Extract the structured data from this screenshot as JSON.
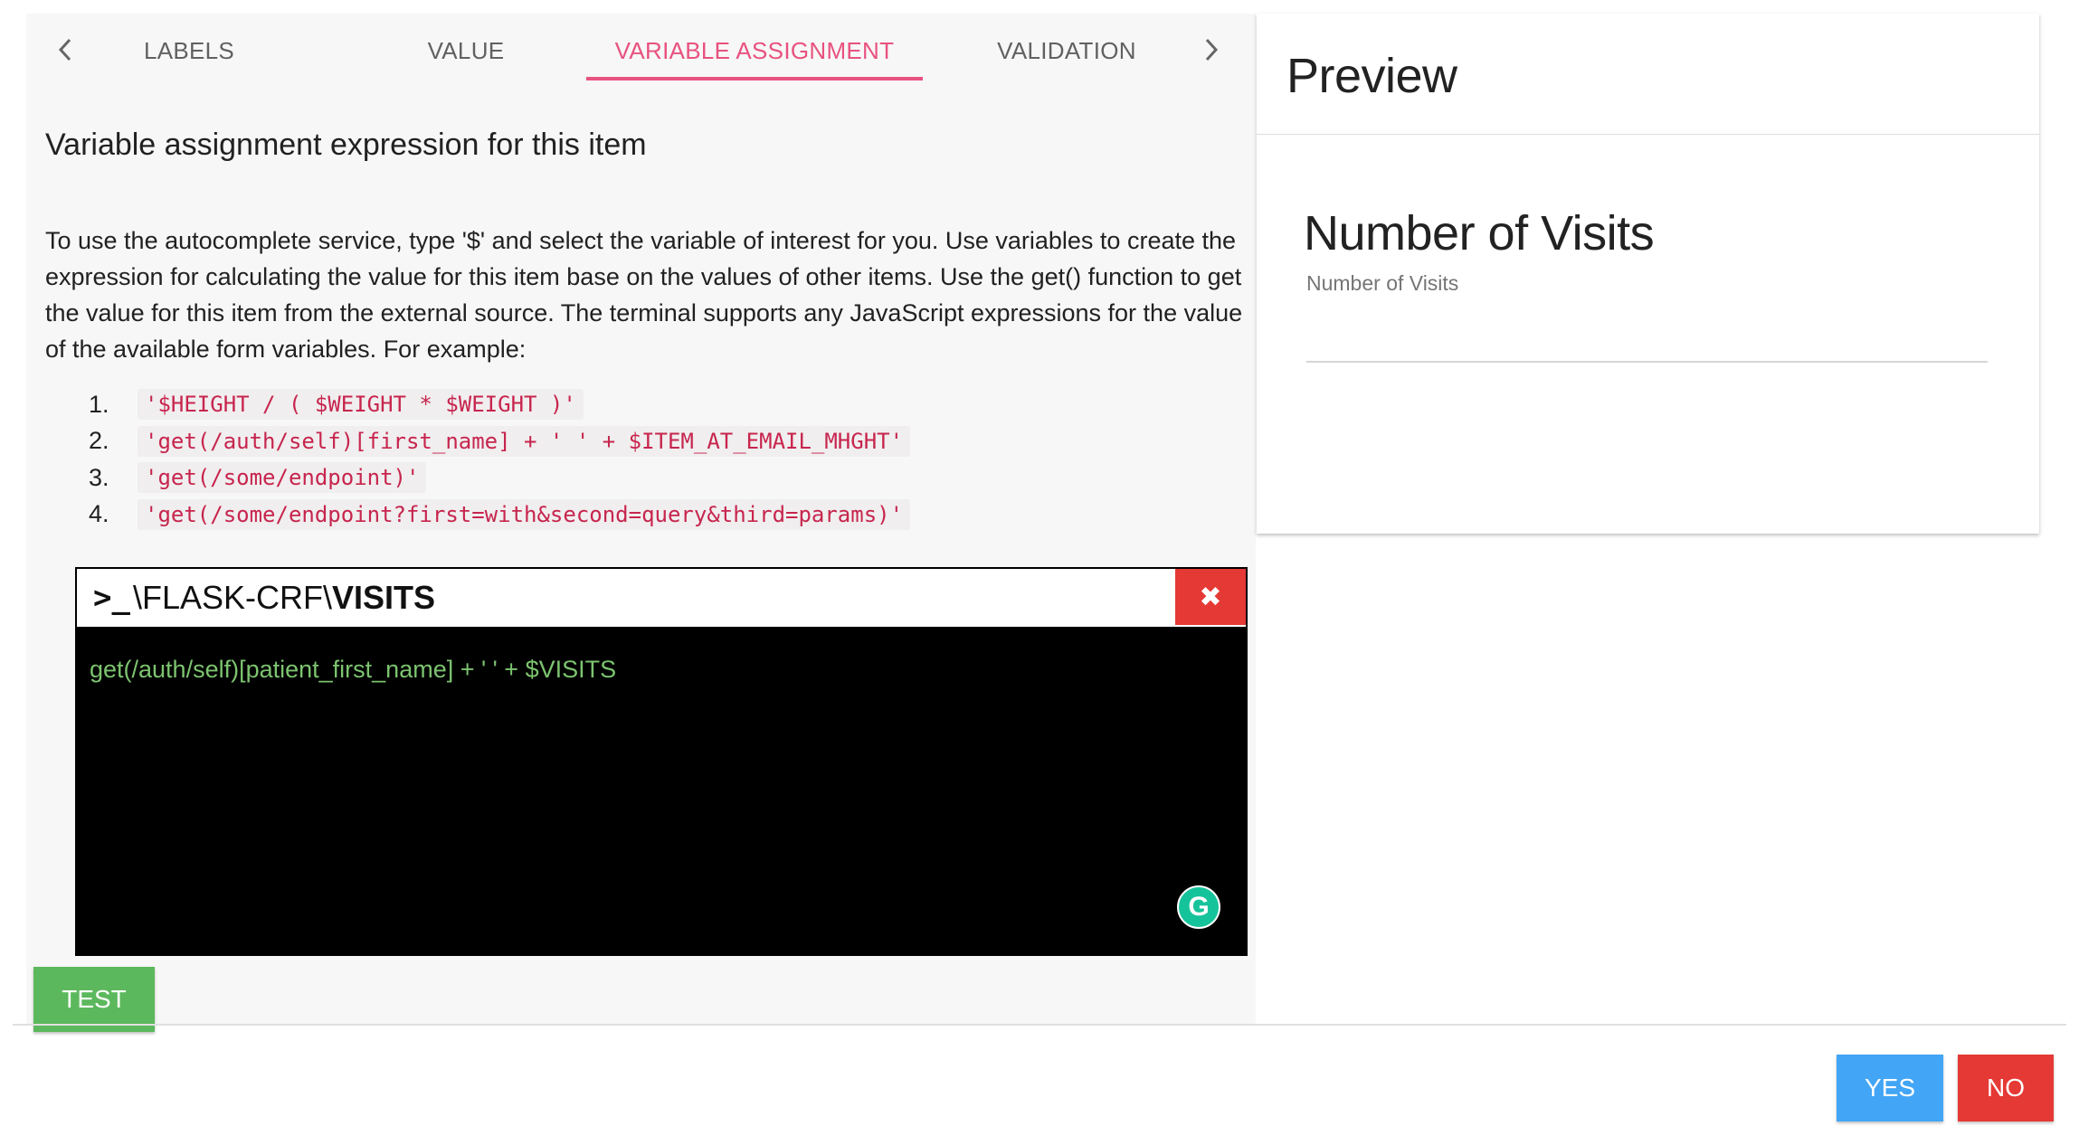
{
  "tabs": {
    "items": [
      "LABELS",
      "VALUE",
      "VARIABLE ASSIGNMENT",
      "VALIDATION"
    ],
    "active": "VARIABLE ASSIGNMENT",
    "prev_icon": "chevron-left-icon",
    "next_icon": "chevron-right-icon"
  },
  "editor": {
    "title": "Variable assignment expression for this item",
    "description": "To use the autocomplete service, type '$' and select the variable of interest for you. Use variables to create the expression for calculating the value for this item base on the values of other items. Use the get() function to get the value for this item from the external source. The terminal supports any JavaScript expressions for the value of the available form variables. For example:",
    "examples": [
      {
        "num": "1.",
        "code": "'$HEIGHT / ( $WEIGHT * $WEIGHT )'"
      },
      {
        "num": "2.",
        "code": "'get(/auth/self)[first_name] + ' ' + $ITEM_AT_EMAIL_MHGHT'"
      },
      {
        "num": "3.",
        "code": "'get(/some/endpoint)'"
      },
      {
        "num": "4.",
        "code": "'get(/some/endpoint?first=with&second=query&third=params)'"
      }
    ]
  },
  "terminal": {
    "prompt_icon": ">_",
    "path_prefix": "\\FLASK-CRF\\",
    "path_name": "VISITS",
    "close_icon": "close-icon",
    "input_value": "get(/auth/self)[patient_first_name] + ' ' + $VISITS",
    "grammarly_icon": "grammarly-icon"
  },
  "buttons": {
    "test": "TEST",
    "yes": "YES",
    "no": "NO"
  },
  "preview": {
    "title": "Preview",
    "field_label": "Number of Visits",
    "field_sublabel": "Number of Visits"
  },
  "colors": {
    "accent": "#e8527f",
    "code_text": "#c7254e",
    "terminal_text": "#7cc46f",
    "test_button": "#5cb85c",
    "yes_button": "#42a5f5",
    "no_button": "#e53935"
  }
}
